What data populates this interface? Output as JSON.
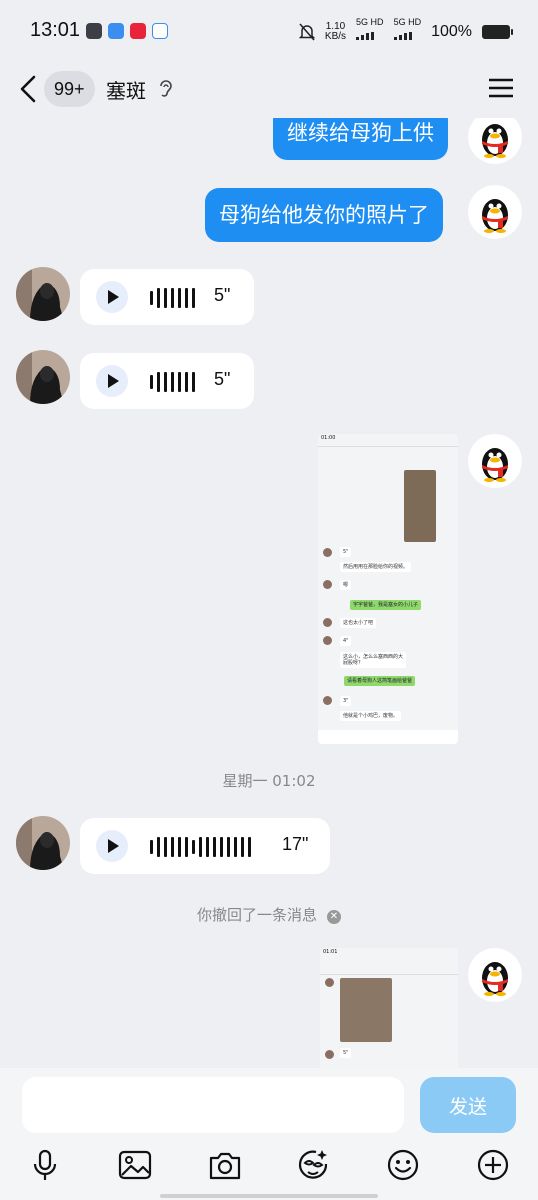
{
  "status_bar": {
    "time": "13:01",
    "net_speed_value": "1.10",
    "net_speed_unit": "KB/s",
    "sim1": "5G HD",
    "sim2": "5G HD",
    "battery": "100%"
  },
  "header": {
    "unread_count": "99+",
    "title": "塞斑"
  },
  "messages": {
    "sent_1": "继续给母狗上供",
    "sent_2": "母狗给他发你的照片了",
    "voice_1_duration": "5\"",
    "voice_2_duration": "5\"",
    "timestamp": "星期一 01:02",
    "voice_3_duration": "17\"",
    "recall_notice": "你撤回了一条消息"
  },
  "screenshot_1": {
    "time": "01:00",
    "lines": [
      "5\"",
      "然后用用在那脸给你的视频。",
      "嗯",
      "宇宇爸爸，我是塞女的小儿子",
      "这也太小了吧",
      "4\"",
      "这么小，怎么么塞西西的大屁股呀？",
      "请看着母狗人这简笔画给爸爸",
      "3\"",
      "他就是个小鸡巴，废物。"
    ]
  },
  "screenshot_2": {
    "time": "01:01",
    "voice": "5\""
  },
  "input": {
    "placeholder": "",
    "send_label": "发送"
  },
  "colors": {
    "bubble_sent": "#1e8ef2",
    "send_button": "#8ccaf6",
    "background": "#eeeff2"
  }
}
